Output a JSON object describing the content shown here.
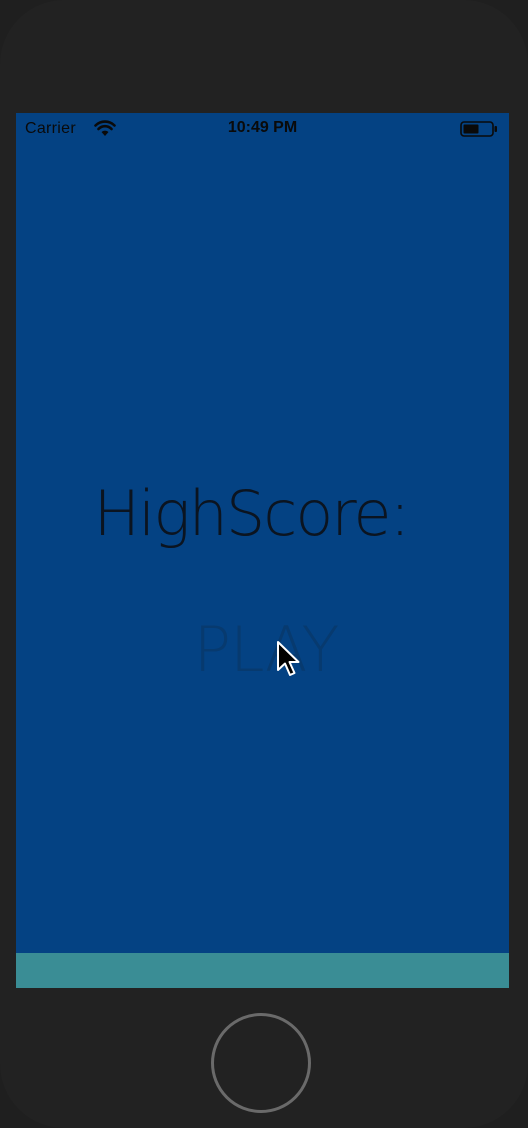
{
  "status_bar": {
    "carrier": "Carrier",
    "time": "10:49 PM",
    "wifi_icon": "wifi-icon",
    "battery_icon": "battery-icon"
  },
  "game": {
    "highscore_label": "HighScore:",
    "play_label": "PLAY"
  },
  "colors": {
    "background": "#044283",
    "footer": "#3a8d95",
    "device_frame": "#222222"
  },
  "icons": {
    "cursor": "mouse-pointer-icon",
    "home": "home-button-icon"
  }
}
